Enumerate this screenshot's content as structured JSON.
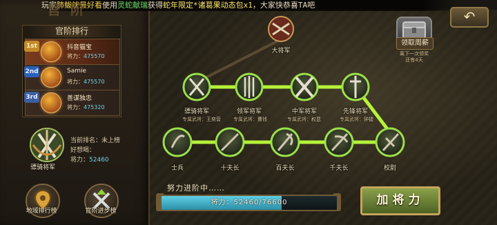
{
  "marquee": {
    "prefix": "玩家",
    "player": "肺鲅鲅最好看",
    "mid1": "使用",
    "item": "灵蛇献瑞",
    "mid2": "获得",
    "reward": "蛇年限定*诸葛果动态包x1",
    "suffix": "，大家快恭喜TA吧"
  },
  "title": "官阶",
  "ranking": {
    "title": "官阶排行",
    "power_label": "将力：",
    "rows": [
      {
        "badge": "1st",
        "name": "抖音猫宝",
        "power": "475570"
      },
      {
        "badge": "2nd",
        "name": "Samie",
        "power": "475570"
      },
      {
        "badge": "3rd",
        "name": "善谋独忠",
        "power": "475320"
      }
    ]
  },
  "self": {
    "rank_emblem_name": "骠骑将军",
    "rank_label": "当前排名：",
    "rank_value": "未上榜",
    "quote_label": "好想喝：",
    "power_label": "将力：",
    "power_value": "52460"
  },
  "buttons": {
    "region_rank": "地域排行榜",
    "promotion_rank": "官阶进步榜",
    "salary": "领取周薪",
    "salary_note_1": "离下一次领奖",
    "salary_note_2": "还有4天",
    "add_general": "加将力"
  },
  "tree": {
    "top": {
      "name": "大将军"
    },
    "generals": [
      {
        "name": "骠骑将军",
        "sub_label": "专属武将：",
        "sub_value": "王奕营"
      },
      {
        "name": "领军将军",
        "sub_label": "专属武将：",
        "sub_value": "曹钱"
      },
      {
        "name": "中军将军",
        "sub_label": "专属武将：",
        "sub_value": "权昆"
      },
      {
        "name": "先锋将军",
        "sub_label": "专属武将：",
        "sub_value": "钟捷"
      }
    ],
    "ranks": [
      {
        "name": "士兵"
      },
      {
        "name": "十夫长"
      },
      {
        "name": "百夫长"
      },
      {
        "name": "千夫长"
      },
      {
        "name": "校尉"
      }
    ]
  },
  "progress": {
    "title": "努力进阶中……",
    "label": "将力：",
    "current": 52460,
    "target": 76600,
    "text": "52460/76600"
  },
  "colors": {
    "path_active": "#b6f23a",
    "node_glow": "#9be04a",
    "accent_gold": "#c4a55a",
    "progress_fill": "#5fd0e6"
  }
}
